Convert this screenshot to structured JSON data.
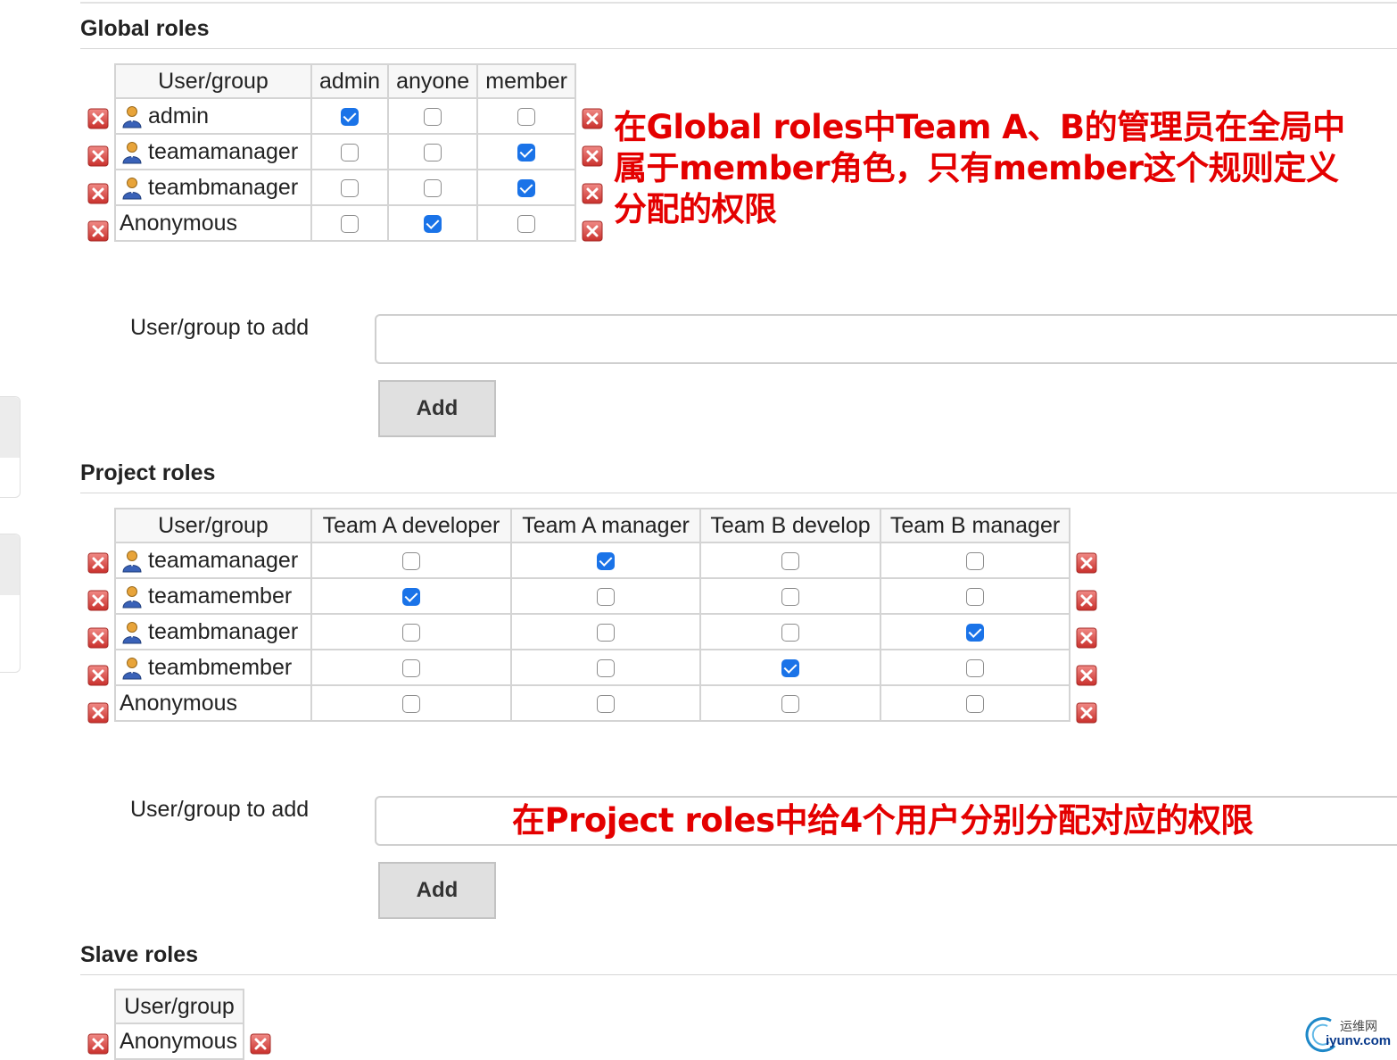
{
  "global_roles": {
    "title": "Global roles",
    "header": [
      "User/group",
      "admin",
      "anyone",
      "member"
    ],
    "rows": [
      {
        "name": "admin",
        "user_icon": true,
        "checks": [
          true,
          false,
          false
        ]
      },
      {
        "name": "teamamanager",
        "user_icon": true,
        "checks": [
          false,
          false,
          true
        ]
      },
      {
        "name": "teambmanager",
        "user_icon": true,
        "checks": [
          false,
          false,
          true
        ]
      },
      {
        "name": "Anonymous",
        "user_icon": false,
        "checks": [
          false,
          true,
          false
        ]
      }
    ],
    "add_label": "User/group to add",
    "add_value": "",
    "add_button": "Add"
  },
  "project_roles": {
    "title": "Project roles",
    "header": [
      "User/group",
      "Team A developer",
      "Team A manager",
      "Team B develop",
      "Team B manager"
    ],
    "rows": [
      {
        "name": "teamamanager",
        "user_icon": true,
        "checks": [
          false,
          true,
          false,
          false
        ]
      },
      {
        "name": "teamamember",
        "user_icon": true,
        "checks": [
          true,
          false,
          false,
          false
        ]
      },
      {
        "name": "teambmanager",
        "user_icon": true,
        "checks": [
          false,
          false,
          false,
          true
        ]
      },
      {
        "name": "teambmember",
        "user_icon": true,
        "checks": [
          false,
          false,
          true,
          false
        ]
      },
      {
        "name": "Anonymous",
        "user_icon": false,
        "checks": [
          false,
          false,
          false,
          false
        ]
      }
    ],
    "add_label": "User/group to add",
    "add_value": "",
    "add_button": "Add"
  },
  "slave_roles": {
    "title": "Slave roles",
    "header": [
      "User/group"
    ],
    "rows": [
      {
        "name": "Anonymous",
        "user_icon": false,
        "checks": []
      }
    ]
  },
  "annotations": {
    "global": [
      "在Global roles中Team A、B的管理员在全局中",
      "属于member角色，只有member这个规则定义",
      "分配的权限"
    ],
    "project": "在Project roles中给4个用户分别分配对应的权限"
  },
  "watermark": {
    "cn": "运维网",
    "en": "iyunv.com"
  },
  "colors": {
    "checkbox_checked": "#1a73e8",
    "delete_icon": "#d9534f",
    "annotation": "#e40000"
  }
}
